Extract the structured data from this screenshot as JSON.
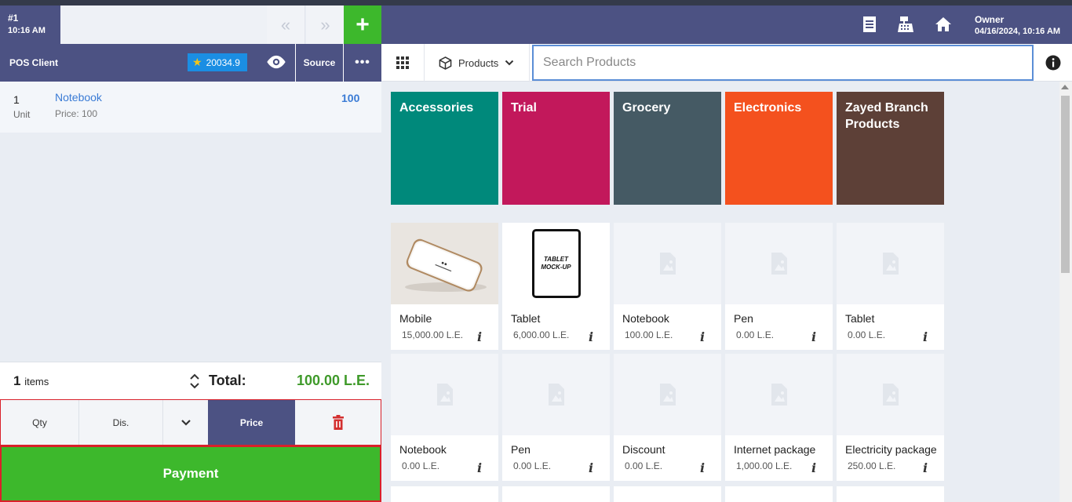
{
  "order_tab": {
    "number": "#1",
    "time": "10:16 AM"
  },
  "nav": {
    "prev_glyph": "«",
    "next_glyph": "»",
    "add_glyph": "+"
  },
  "client": {
    "name": "POS Client",
    "points": "20034.9",
    "source_label": "Source",
    "more_glyph": "•••"
  },
  "order_lines": [
    {
      "qty": "1",
      "unit": "Unit",
      "name": "Notebook",
      "price_label": "Price: 100",
      "total": "100"
    }
  ],
  "summary": {
    "items_count": "1",
    "items_label": "items",
    "total_label": "Total:",
    "total_value": "100.00 L.E."
  },
  "actions": {
    "qty": "Qty",
    "discount": "Dis.",
    "price": "Price"
  },
  "payment_label": "Payment",
  "header": {
    "user": "Owner",
    "datetime": "04/16/2024, 10:16 AM"
  },
  "search": {
    "dropdown_label": "Products",
    "placeholder": "Search Products"
  },
  "categories": [
    {
      "name": "Accessories",
      "color": "#00897b"
    },
    {
      "name": "Trial",
      "color": "#c2185b"
    },
    {
      "name": "Grocery",
      "color": "#455a64"
    },
    {
      "name": "Electronics",
      "color": "#f4511e"
    },
    {
      "name": "Zayed Branch Products",
      "color": "#5d4037"
    }
  ],
  "products": [
    {
      "name": "Mobile",
      "price": "15,000.00 L.E.",
      "image": "phone-mockup"
    },
    {
      "name": "Tablet",
      "price": "6,000.00 L.E.",
      "image": "tablet-mockup",
      "image_text": "TABLET MOCK-UP"
    },
    {
      "name": "Notebook",
      "price": "100.00 L.E.",
      "image": "placeholder"
    },
    {
      "name": "Pen",
      "price": "0.00 L.E.",
      "image": "placeholder"
    },
    {
      "name": "Tablet",
      "price": "0.00 L.E.",
      "image": "placeholder"
    },
    {
      "name": "Notebook",
      "price": "0.00 L.E.",
      "image": "placeholder"
    },
    {
      "name": "Pen",
      "price": "0.00 L.E.",
      "image": "placeholder"
    },
    {
      "name": "Discount",
      "price": "0.00 L.E.",
      "image": "placeholder"
    },
    {
      "name": "Internet package",
      "price": "1,000.00 L.E.",
      "image": "placeholder"
    },
    {
      "name": "Electricity package",
      "price": "250.00 L.E.",
      "image": "placeholder"
    }
  ],
  "product_info_glyph": "i",
  "colors": {
    "primary": "#4c5283",
    "success": "#3db82c",
    "danger": "#d9202a",
    "link": "#3a7bd5"
  }
}
